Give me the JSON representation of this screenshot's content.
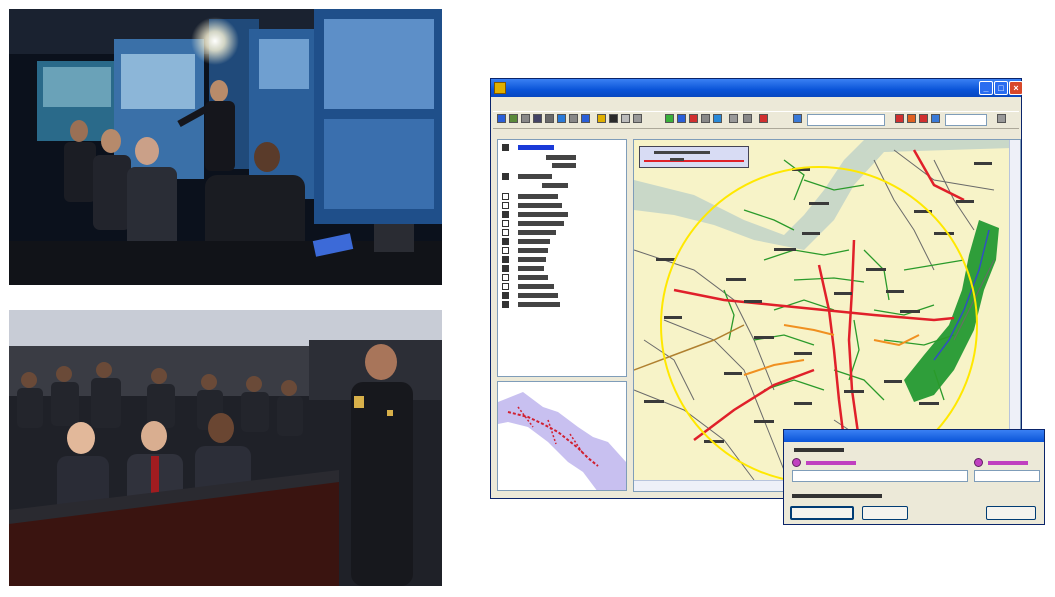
{
  "photos": [
    {
      "name": "command-center-photo-top"
    },
    {
      "name": "command-center-photo-bottom"
    }
  ],
  "app": {
    "window_controls": {
      "minimize": "_",
      "maximize": "□",
      "close": "×"
    }
  },
  "colors": {
    "titlebar": "#0a54d8",
    "map_background": "#f7f3c8",
    "water": "#c9d8c8",
    "park": "#2f9e3a",
    "major_road": "#e0202a",
    "minor_road": "#2a9a2a",
    "search_radius": "#ffe800"
  }
}
